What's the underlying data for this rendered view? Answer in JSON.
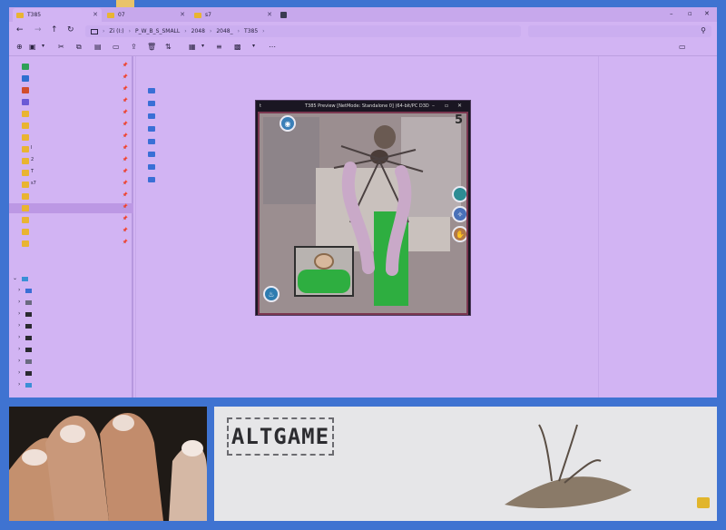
{
  "tabs": [
    {
      "label": "T385"
    },
    {
      "label": "07"
    },
    {
      "label": "s7"
    }
  ],
  "address": {
    "crumbs": [
      "Zi (I:)",
      "P_W_B_S_SMALL",
      "2048",
      "2048_",
      "T385"
    ],
    "search_placeholder": ""
  },
  "sidebar": {
    "quick_access": [
      {
        "label": "",
        "icon": "download-icon",
        "color": "#2ea056"
      },
      {
        "label": "",
        "icon": "image-icon",
        "color": "#2f6fd0"
      },
      {
        "label": "",
        "icon": "record-icon",
        "color": "#d24d2b"
      },
      {
        "label": "",
        "icon": "video-icon",
        "color": "#6b5ad6"
      },
      {
        "label": "",
        "icon": "folder-icon",
        "color": "#e9b431"
      },
      {
        "label": "",
        "icon": "folder-icon",
        "color": "#e9b431"
      },
      {
        "label": "",
        "icon": "folder-icon",
        "color": "#e9b431"
      },
      {
        "label": "I",
        "icon": "folder-icon",
        "color": "#e9b431"
      },
      {
        "label": "2",
        "icon": "folder-icon",
        "color": "#e9b431"
      },
      {
        "label": "T",
        "icon": "folder-icon",
        "color": "#e9b431"
      },
      {
        "label": "s7",
        "icon": "folder-icon",
        "color": "#e9b431"
      },
      {
        "label": "",
        "icon": "folder-icon",
        "color": "#e9b431"
      },
      {
        "label": "",
        "icon": "folder-icon",
        "color": "#e9b431",
        "selected": true
      },
      {
        "label": "",
        "icon": "folder-icon",
        "color": "#e9b431"
      },
      {
        "label": "",
        "icon": "folder-icon",
        "color": "#e9b431"
      },
      {
        "label": "",
        "icon": "folder-icon",
        "color": "#e9b431"
      }
    ]
  },
  "preview_window": {
    "title": "T385 Preview [NetMode: Standalone 0] (64-bit/PC D3D",
    "app_label": "t",
    "score": "5"
  },
  "banner": {
    "logo_text": "ALTGAME"
  },
  "colors": {
    "desktop": "#3f73d1",
    "window_bg": "#d2b4f3",
    "folder_blue": "#3a6fd6",
    "folder_yellow": "#e9b431"
  }
}
